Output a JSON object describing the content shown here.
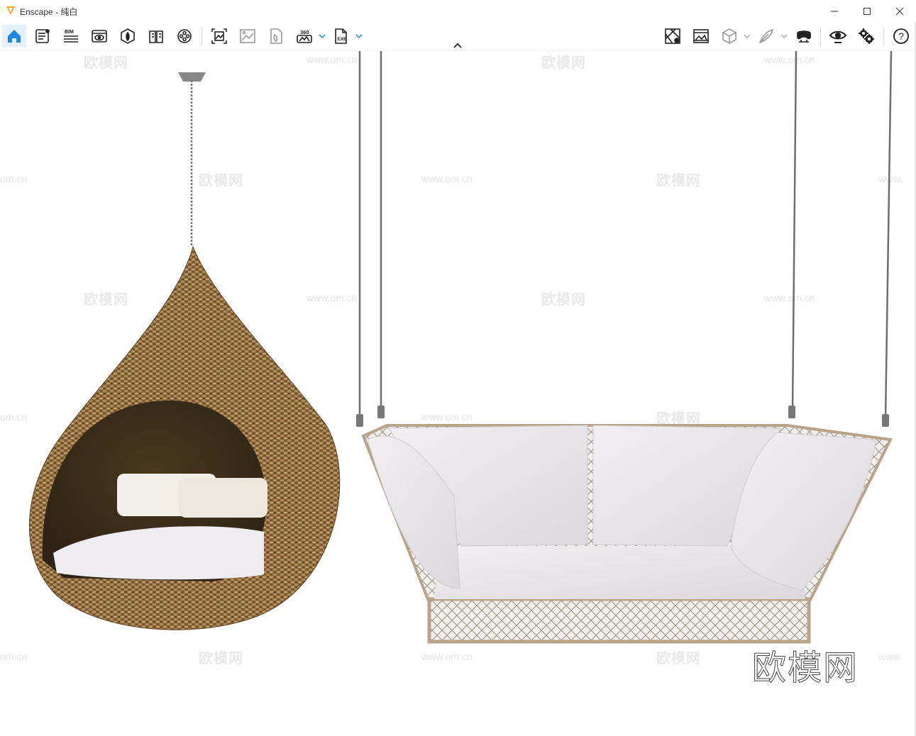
{
  "window": {
    "app_name": "Enscape",
    "separator": " - ",
    "document": "纯白",
    "accent": "#f6a71c"
  },
  "toolbar": {
    "left": [
      {
        "name": "home-icon",
        "active": true
      },
      {
        "name": "document-settings-icon"
      },
      {
        "name": "bim-icon",
        "label": "BIM"
      },
      {
        "name": "view-management-icon"
      },
      {
        "name": "asset-library-icon"
      },
      {
        "name": "material-editor-icon"
      },
      {
        "name": "video-editor-icon"
      },
      {
        "name": "render-image-icon"
      },
      {
        "name": "batch-render-icon"
      },
      {
        "name": "render-panorama-icon"
      },
      {
        "name": "export-360-icon",
        "label": "360"
      },
      {
        "name": "export-exe-icon",
        "label": "EXE"
      }
    ],
    "right": [
      {
        "name": "map-icon"
      },
      {
        "name": "image-capture-icon"
      },
      {
        "name": "cube-icon"
      },
      {
        "name": "feather-icon"
      },
      {
        "name": "vr-headset-icon"
      },
      {
        "name": "eye-icon"
      },
      {
        "name": "settings-gears-icon"
      },
      {
        "name": "help-icon",
        "label": "?"
      }
    ]
  },
  "watermarks": {
    "site": "欧模网",
    "url": "www.om.cn",
    "url_short": "om.cn",
    "url_prefix": "www.",
    "brand": "欧模网"
  }
}
